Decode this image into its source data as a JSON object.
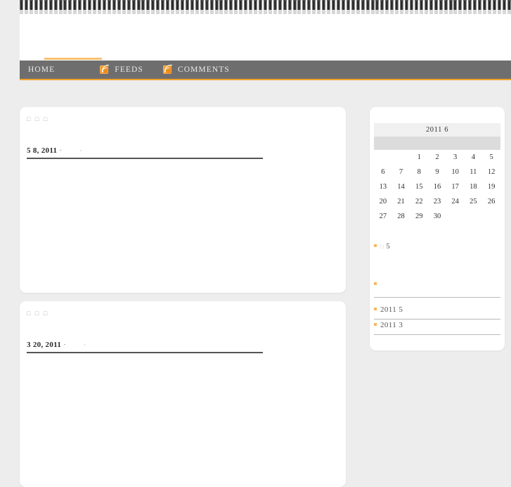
{
  "site": {
    "title": "",
    "background_color": "#ededed",
    "accent_color": "#f0a229",
    "nav_background": "#6e6e6e"
  },
  "nav": {
    "items": [
      {
        "label": "HOME",
        "icon": null
      },
      {
        "label": "FEEDS",
        "icon": "rss-icon"
      },
      {
        "label": "COMMENTS",
        "icon": "rss-icon"
      }
    ]
  },
  "posts": [
    {
      "meta_top": "□ □ □",
      "title": "",
      "date": "5  8, 2011",
      "separator": "·",
      "category": "·"
    },
    {
      "meta_top": "□ □ □",
      "title": "",
      "date": "3  20, 2011",
      "separator": "·",
      "category": "·"
    }
  ],
  "sidebar": {
    "calendar": {
      "caption": "2011  6",
      "weekday_headers": [
        "",
        "",
        "",
        "",
        "",
        "",
        ""
      ],
      "weeks": [
        [
          "",
          "",
          "1",
          "2",
          "3",
          "4",
          "5"
        ],
        [
          "6",
          "7",
          "8",
          "9",
          "10",
          "11",
          "12"
        ],
        [
          "13",
          "14",
          "15",
          "16",
          "17",
          "18",
          "19"
        ],
        [
          "20",
          "21",
          "22",
          "23",
          "24",
          "25",
          "26"
        ],
        [
          "27",
          "28",
          "29",
          "30",
          "",
          "",
          ""
        ]
      ]
    },
    "recent_widget": {
      "items": [
        {
          "tofu": "□",
          "label": "5",
          "ruled": false
        },
        {
          "tofu": "",
          "label": "",
          "ruled": true
        }
      ]
    },
    "archives_widget": {
      "items": [
        {
          "tofu": "",
          "label": "2011  5",
          "ruled": true
        },
        {
          "tofu": "",
          "label": "2011  3",
          "ruled": true
        }
      ]
    }
  }
}
